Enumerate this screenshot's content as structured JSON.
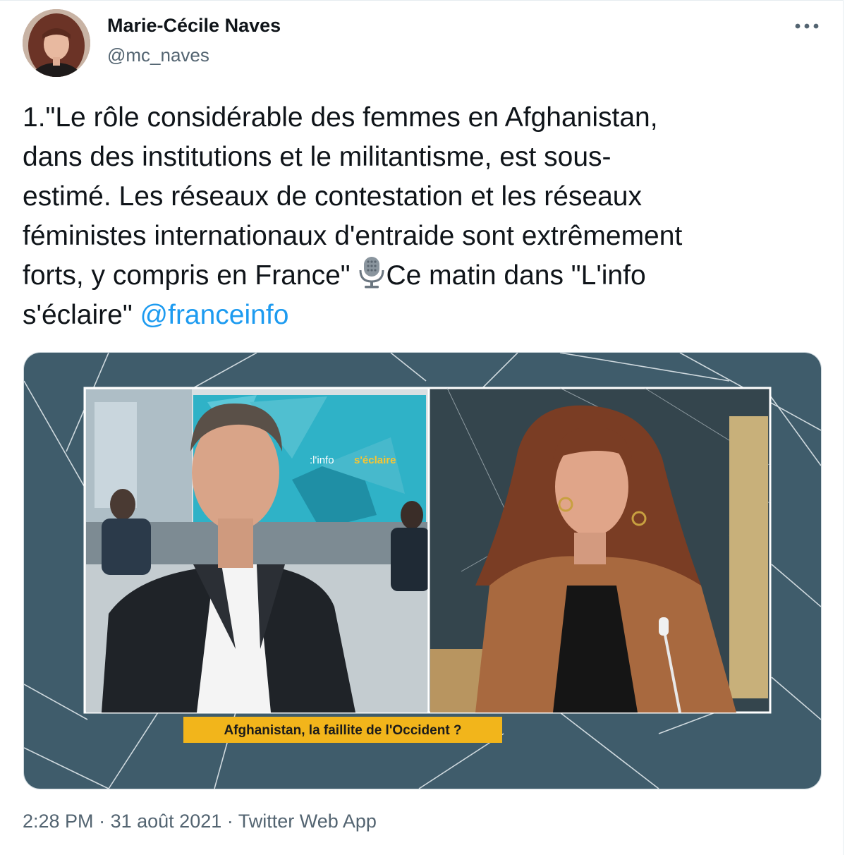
{
  "author": {
    "name": "Marie-Cécile Naves",
    "handle": "@mc_naves"
  },
  "tweet": {
    "text_part1": "1.\"Le rôle considérable des femmes en Afghanistan,\ndans des institutions et le militantisme, est sous-\nestimé. Les réseaux de contestation et les réseaux\nféministes internationaux d'entraide sont extrêmement\nforts, y compris en France\" ",
    "text_part2": "Ce matin dans \"L'info\ns'éclaire\" ",
    "mention": "@franceinfo",
    "emoji": "microphone-icon"
  },
  "media": {
    "screen_label_prefix": ":l'info",
    "screen_label_accent": "s'éclaire",
    "banner": "Afghanistan, la faillite de l'Occident ?"
  },
  "meta": {
    "time": "2:28 PM",
    "separator": "·",
    "date": "31 août 2021",
    "source": "Twitter Web App"
  },
  "colors": {
    "link": "#1d9bf0",
    "secondary_text": "#536471",
    "banner_bg": "#f2b51b",
    "studio_bg": "#3f5c6b"
  }
}
